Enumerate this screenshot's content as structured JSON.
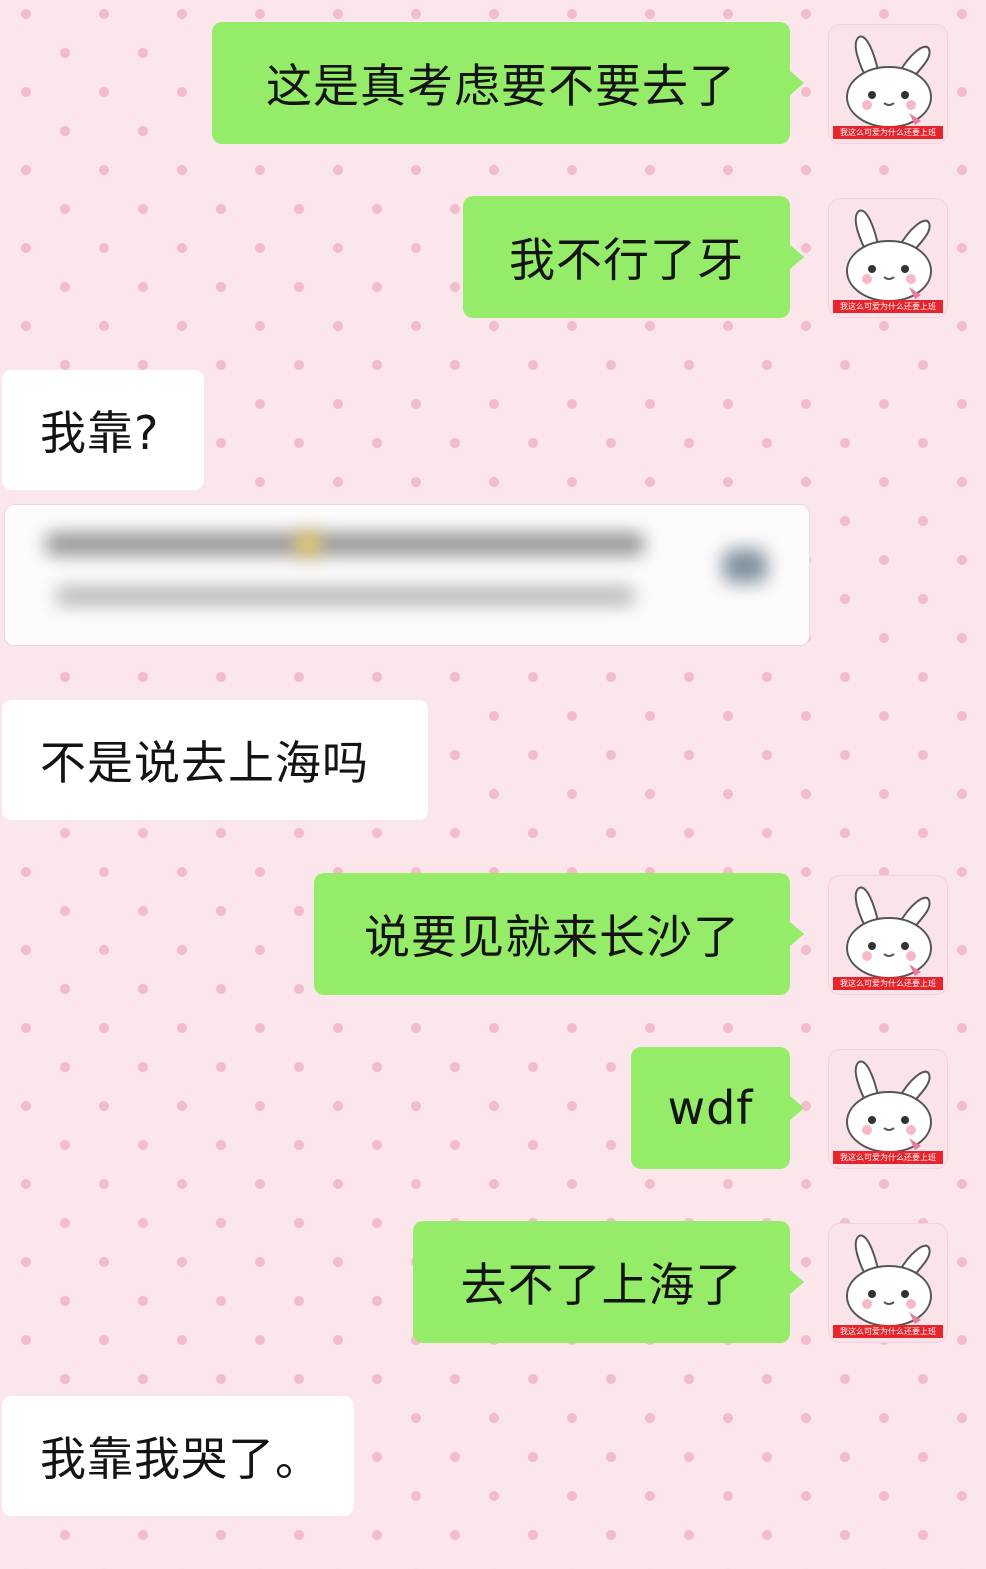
{
  "avatar": {
    "caption": "我这么可爱为什么还要上班"
  },
  "messages": [
    {
      "side": "out",
      "text": "这是真考虑要不要去了"
    },
    {
      "side": "out",
      "text": "我不行了牙"
    },
    {
      "side": "in",
      "text": "我靠?"
    },
    {
      "side": "in",
      "type": "blurred-link-card"
    },
    {
      "side": "in",
      "text": "不是说去上海吗"
    },
    {
      "side": "out",
      "text": "说要见就来长沙了"
    },
    {
      "side": "out",
      "text": "wdf"
    },
    {
      "side": "out",
      "text": "去不了上海了"
    },
    {
      "side": "in",
      "text": "我靠我哭了。"
    }
  ],
  "colors": {
    "background": "#fbe6ec",
    "background_dots": "#f2bccb",
    "outgoing_bubble": "#95ec69",
    "incoming_bubble": "#ffffff",
    "avatar_caption_bar": "#e8232b"
  }
}
